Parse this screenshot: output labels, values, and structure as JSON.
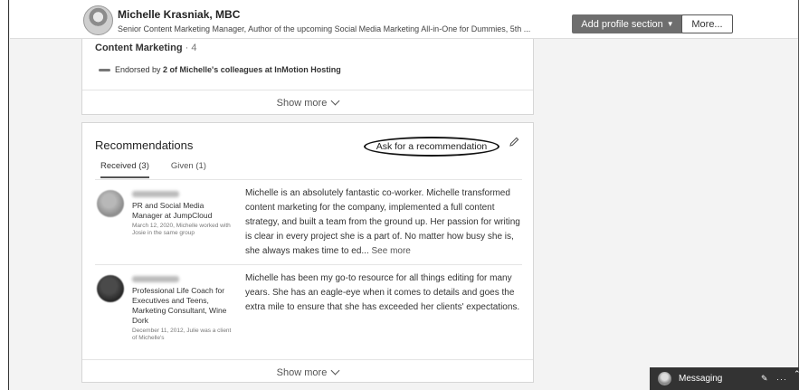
{
  "header": {
    "name": "Michelle Krasniak, MBC",
    "headline": "Senior Content Marketing Manager, Author of the upcoming Social Media Marketing All-in-One for Dummies, 5th ...",
    "add_section_label": "Add profile section",
    "more_label": "More..."
  },
  "skills": {
    "skill_name": "Content Marketing",
    "skill_count": " · 4",
    "endorsed_prefix": "Endorsed by ",
    "endorsed_bold": "2 of Michelle's colleagues at InMotion Hosting",
    "show_more": "Show more"
  },
  "recommendations": {
    "title": "Recommendations",
    "ask_label": "Ask for a recommendation",
    "tabs": [
      {
        "label": "Received (3)",
        "active": true
      },
      {
        "label": "Given (1)",
        "active": false
      }
    ],
    "items": [
      {
        "role": "PR and Social Media Manager at JumpCloud",
        "meta": "March 12, 2020, Michelle worked with Josie in the same group",
        "text": "Michelle is an absolutely fantastic co-worker. Michelle transformed content marketing for the company, implemented a full content strategy, and built a team from the ground up. Her passion for writing is clear in every project she is a part of. No matter how busy she is, she always makes time to ed...",
        "see_more": "See more"
      },
      {
        "role": "Professional Life Coach for Executives and Teens, Marketing Consultant, Wine Dork",
        "meta": "December 11, 2012, Julie was a client of Michelle's",
        "text": "Michelle has been my go-to resource for all things editing for many years. She has an eagle-eye when it comes to details and goes the extra mile to ensure that she has exceeded her clients' expectations."
      }
    ],
    "show_more": "Show more"
  },
  "messaging": {
    "label": "Messaging"
  },
  "icons": [
    "caret-down-icon",
    "chevron-down-icon",
    "pencil-icon",
    "compose-icon",
    "more-dots-icon",
    "chevron-up-icon"
  ]
}
